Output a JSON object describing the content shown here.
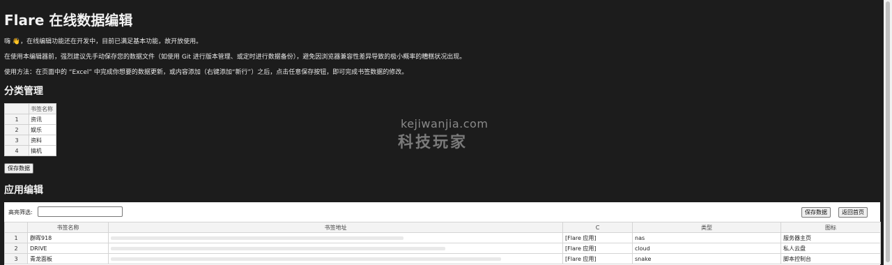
{
  "header": {
    "title": "Flare 在线数据编辑"
  },
  "intro": {
    "line1": "嗨 👋，在线编辑功能还在开发中，目前已满足基本功能，故开放使用。",
    "line2": "在使用本编辑器前，强烈建议先手动保存您的数据文件（如使用 Git 进行版本管理、或定时进行数据备份），避免因浏览器兼容性差异导致的极小概率的糟糕状况出现。",
    "line3": "使用方法：在页面中的 “Excel” 中完成你想要的数据更新，或内容添加（右键添加“新行”）之后，点击任意保存按钮，即可完成书签数据的修改。"
  },
  "category": {
    "heading": "分类管理",
    "column_header": "书签名称",
    "rows": [
      {
        "num": "1",
        "name": "资讯"
      },
      {
        "num": "2",
        "name": "娱乐"
      },
      {
        "num": "3",
        "name": "资料"
      },
      {
        "num": "4",
        "name": "搞机"
      }
    ],
    "save_label": "保存数据"
  },
  "apps": {
    "heading": "应用编辑",
    "filter_label": "高亮筛选:",
    "filter_value": "",
    "save_label": "保存数据",
    "home_label": "返回首页",
    "columns": [
      "书签名称",
      "书签地址",
      "C",
      "类型",
      "图标"
    ],
    "rows": [
      {
        "num": "1",
        "name": "群晖918",
        "url": "",
        "c": "[Flare 应用]",
        "type": "nas",
        "icon": "服务器主页"
      },
      {
        "num": "2",
        "name": "DRIVE",
        "url": "",
        "c": "[Flare 应用]",
        "type": "cloud",
        "icon": "私人云盘"
      },
      {
        "num": "3",
        "name": "青龙面板",
        "url": "",
        "c": "[Flare 应用]",
        "type": "snake",
        "icon": "脚本控制台"
      }
    ]
  },
  "watermark": {
    "domain": "kejiwanjia.com",
    "name": "科技玩家"
  }
}
